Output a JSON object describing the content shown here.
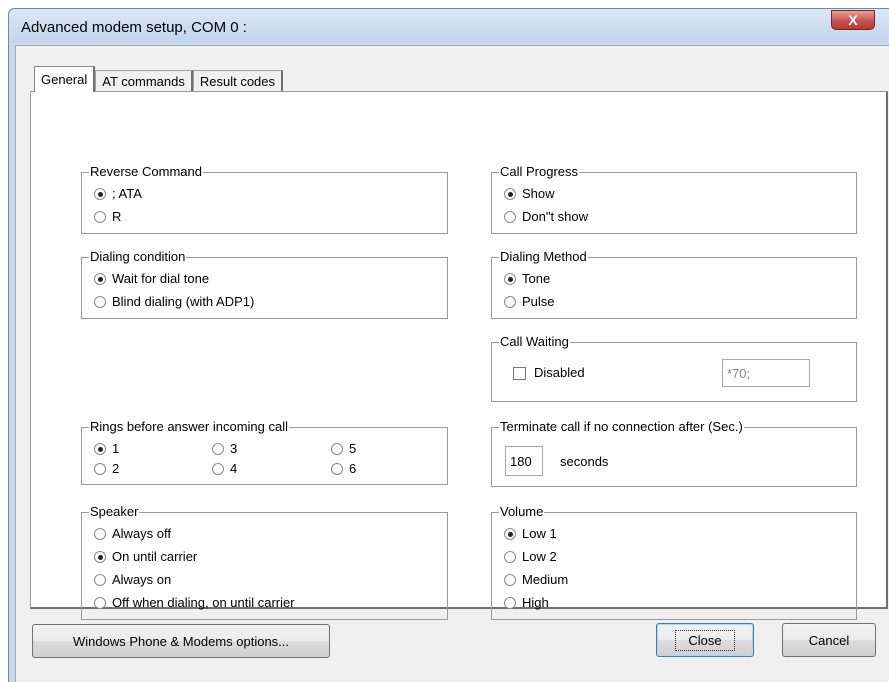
{
  "window": {
    "title": "Advanced modem setup, COM 0 :",
    "close_glyph": "X"
  },
  "tabs": [
    {
      "label": "General",
      "active": true
    },
    {
      "label": "AT commands",
      "active": false
    },
    {
      "label": "Result codes",
      "active": false
    }
  ],
  "reverse_command": {
    "legend": "Reverse Command",
    "options": [
      {
        "label": "; ATA",
        "selected": true
      },
      {
        "label": "R",
        "selected": false
      }
    ]
  },
  "dialing_condition": {
    "legend": "Dialing condition",
    "options": [
      {
        "label": "Wait for dial tone",
        "selected": true
      },
      {
        "label": "Blind dialing (with ADP1)",
        "selected": false
      }
    ]
  },
  "rings": {
    "legend": "Rings before answer incoming call",
    "options": [
      {
        "label": "1",
        "selected": true
      },
      {
        "label": "3",
        "selected": false
      },
      {
        "label": "5",
        "selected": false
      },
      {
        "label": "2",
        "selected": false
      },
      {
        "label": "4",
        "selected": false
      },
      {
        "label": "6",
        "selected": false
      }
    ]
  },
  "speaker": {
    "legend": "Speaker",
    "options": [
      {
        "label": "Always off",
        "selected": false
      },
      {
        "label": "On until carrier",
        "selected": true
      },
      {
        "label": "Always on",
        "selected": false
      },
      {
        "label": "Off when dialing, on until carrier",
        "selected": false
      }
    ]
  },
  "call_progress": {
    "legend": "Call Progress",
    "options": [
      {
        "label": "Show",
        "selected": true
      },
      {
        "label": "Don\"t show",
        "selected": false
      }
    ]
  },
  "dialing_method": {
    "legend": "Dialing Method",
    "options": [
      {
        "label": "Tone",
        "selected": true
      },
      {
        "label": "Pulse",
        "selected": false
      }
    ]
  },
  "call_waiting": {
    "legend": "Call Waiting",
    "checkbox_label": "Disabled",
    "checked": false,
    "code_value": "*70;"
  },
  "terminate": {
    "legend": "Terminate call if no connection after (Sec.)",
    "value": "180",
    "unit_label": "seconds"
  },
  "volume": {
    "legend": "Volume",
    "options": [
      {
        "label": "Low 1",
        "selected": true
      },
      {
        "label": "Low 2",
        "selected": false
      },
      {
        "label": "Medium",
        "selected": false
      },
      {
        "label": "High",
        "selected": false
      }
    ]
  },
  "buttons": {
    "phone_modem": "Windows Phone & Modems options...",
    "close": "Close",
    "cancel": "Cancel"
  }
}
